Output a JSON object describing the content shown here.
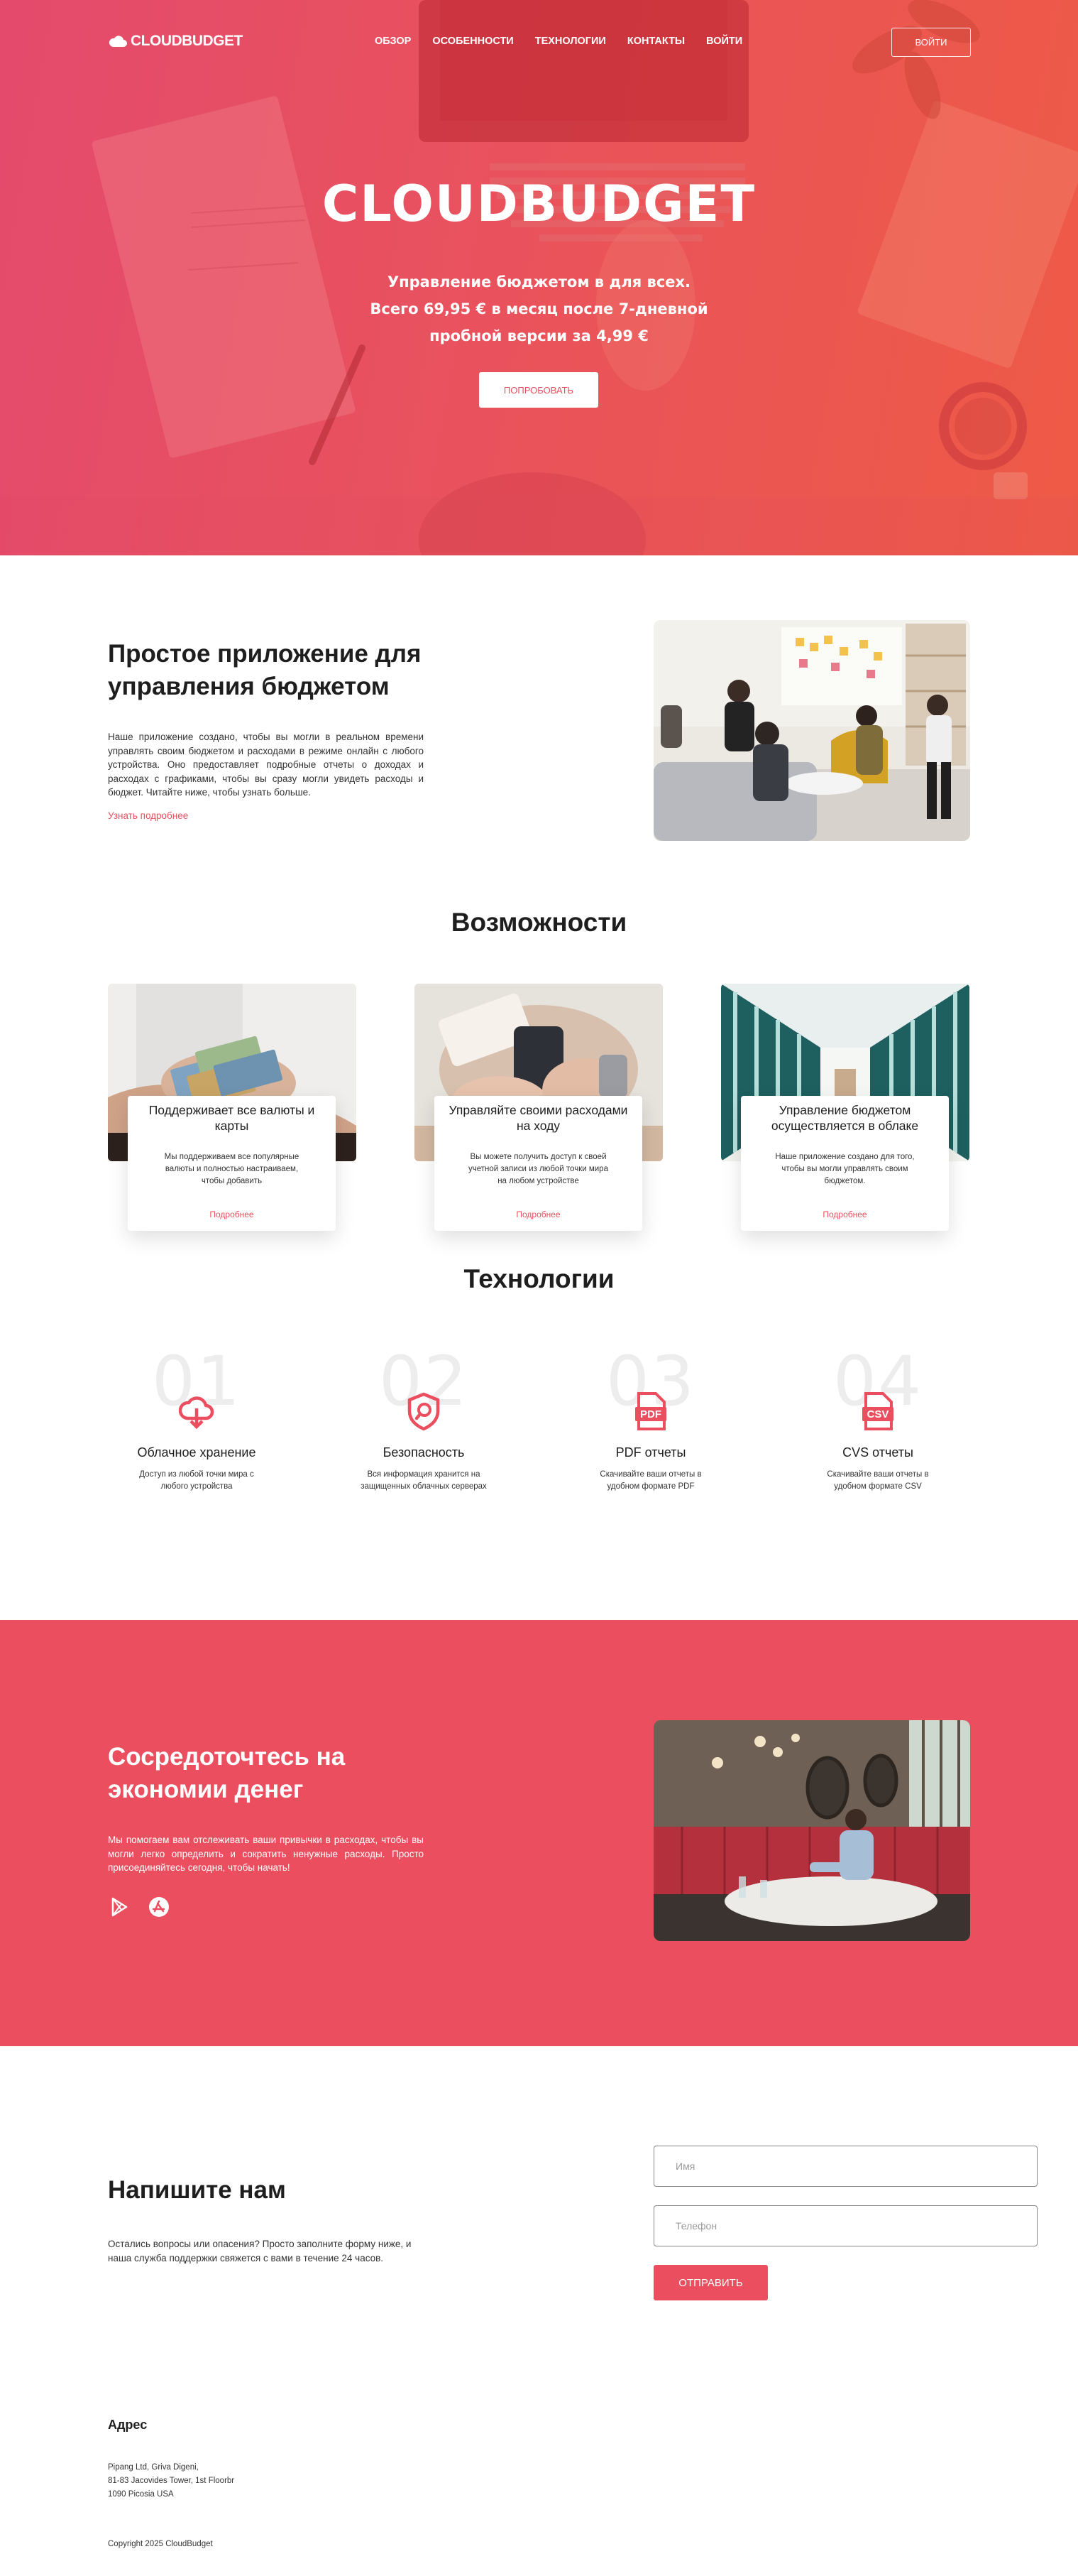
{
  "colors": {
    "accent": "#eb4e5e",
    "hero_start": "#e44a6c",
    "hero_end": "#ee5a45"
  },
  "header": {
    "logo": "CLOUDBUDGET",
    "nav": [
      "ОБЗОР",
      "ОСОБЕННОСТИ",
      "ТЕХНОЛОГИИ",
      "КОНТАКТЫ",
      "ВОЙТИ"
    ],
    "login_button": "ВОЙТИ"
  },
  "hero": {
    "title": "CLOUDBUDGET",
    "subtitle_lines": [
      "Управление бюджетом в для всех.",
      "Всего 69,95 € в месяц после 7-дневной",
      "пробной версии за 4,99 €"
    ],
    "cta": "ПОПРОБОВАТЬ"
  },
  "about": {
    "title": "Простое приложение для управления бюджетом",
    "text": "Наше приложение создано, чтобы вы могли в реальном времени управлять своим бюджетом и расходами в режиме онлайн с любого устройства. Оно предоставляет подробные отчеты о доходах и расходах с графиками, чтобы вы сразу могли увидеть расходы и бюджет. Читайте ниже, чтобы узнать больше.",
    "link": "Узнать подробнее"
  },
  "features": {
    "title": "Возможности",
    "items": [
      {
        "title": "Поддерживает все валюты и карты",
        "text": "Мы поддерживаем все популярные валюты и полностью настраиваем, чтобы добавить",
        "link": "Подробнее"
      },
      {
        "title": "Управляйте своими расходами на ходу",
        "text": "Вы можете получить доступ к своей учетной записи из любой точки мира на любом устройстве",
        "link": "Подробнее"
      },
      {
        "title": "Управление бюджетом осуществляется в облаке",
        "text": "Наше приложение создано для того, чтобы вы могли управлять своим бюджетом.",
        "link": "Подробнее"
      }
    ]
  },
  "technologies": {
    "title": "Технологии",
    "items": [
      {
        "num": "01",
        "icon": "cloud-download-icon",
        "title": "Облачное хранение",
        "text": "Доступ из любой точки мира с любого устройства"
      },
      {
        "num": "02",
        "icon": "shield-search-icon",
        "title": "Безопасность",
        "text": "Вся информация хранится на защищенных облачных серверах"
      },
      {
        "num": "03",
        "icon": "pdf-file-icon",
        "title": "PDF отчеты",
        "icon_label": "PDF",
        "text": "Скачивайте ваши отчеты в удобном формате PDF"
      },
      {
        "num": "04",
        "icon": "csv-file-icon",
        "title": "CVS отчеты",
        "icon_label": "CSV",
        "text": "Скачивайте ваши отчеты в удобном формате CSV"
      }
    ]
  },
  "save": {
    "title": "Сосредоточтесь на экономии денег",
    "text": "Мы помогаем вам отслеживать ваши привычки в расходах, чтобы вы могли легко определить и сократить ненужные расходы. Просто присоединяйтесь сегодня, чтобы начать!",
    "stores": [
      "google-play-icon",
      "app-store-icon"
    ]
  },
  "contact": {
    "title": "Напишите нам",
    "text": "Остались вопросы или опасения? Просто заполните форму ниже, и наша служба поддержки свяжется с вами в течение 24 часов.",
    "name_placeholder": "Имя",
    "phone_placeholder": "Телефон",
    "submit": "ОТПРАВИТЬ"
  },
  "footer": {
    "address_title": "Адрес",
    "address_lines": [
      "Pipang Ltd, Griva Digeni,",
      "81-83 Jacovides Tower, 1st Floorbr",
      "1090 Picosia USA"
    ],
    "copyright": "Copyright 2025 CloudBudget"
  }
}
